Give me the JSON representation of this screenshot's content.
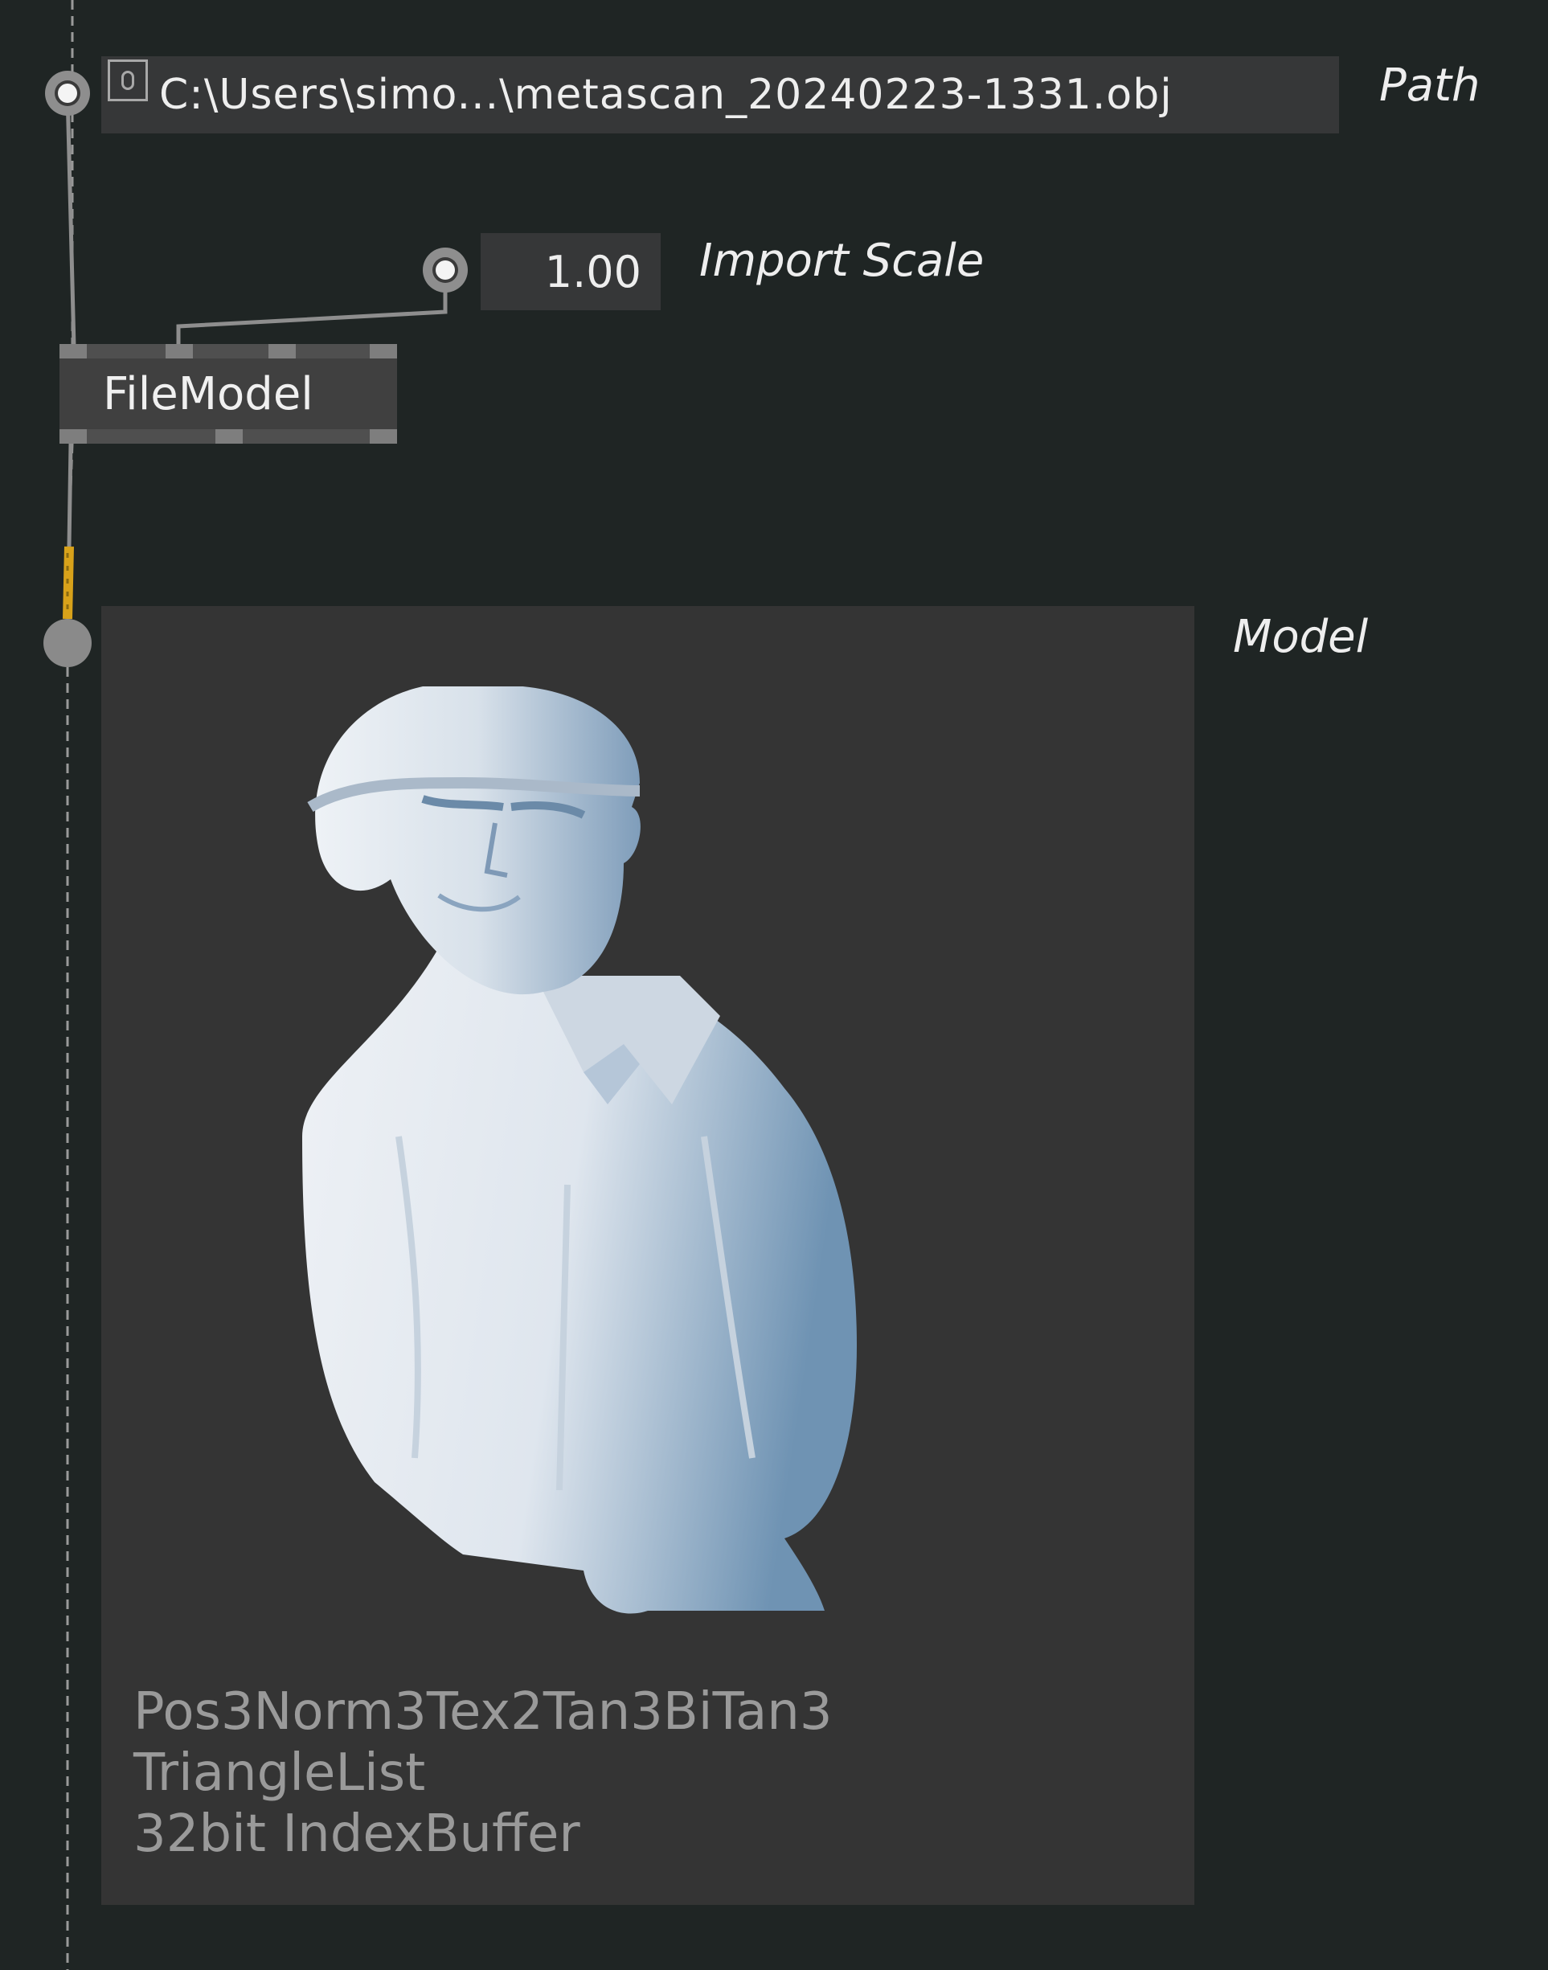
{
  "nodes": {
    "path_iobox": {
      "value": "C:\\Users\\simo...\\metascan_20240223-1331.obj",
      "label": "Path",
      "toggle_icon": "toggle-icon"
    },
    "scale_iobox": {
      "value": "1.00",
      "label": "Import Scale"
    },
    "file_model": {
      "title": "FileModel"
    },
    "model_preview": {
      "label": "Model",
      "info": {
        "vertex_layout": "Pos3Norm3Tex2Tan3BiTan3",
        "topology": "TriangleList",
        "index_buffer": "32bit IndexBuffer"
      },
      "preview_image": "scanned-bust-model"
    }
  },
  "colors": {
    "canvas_background": "#1f2524",
    "iobox_background": "#363738",
    "node_background": "#404040",
    "model_panel_background": "#343434",
    "link_gray": "#8e8e8e",
    "link_highlight": "#d8a21a",
    "text_primary": "#eeeeee",
    "text_info": "#9a9a9a"
  }
}
